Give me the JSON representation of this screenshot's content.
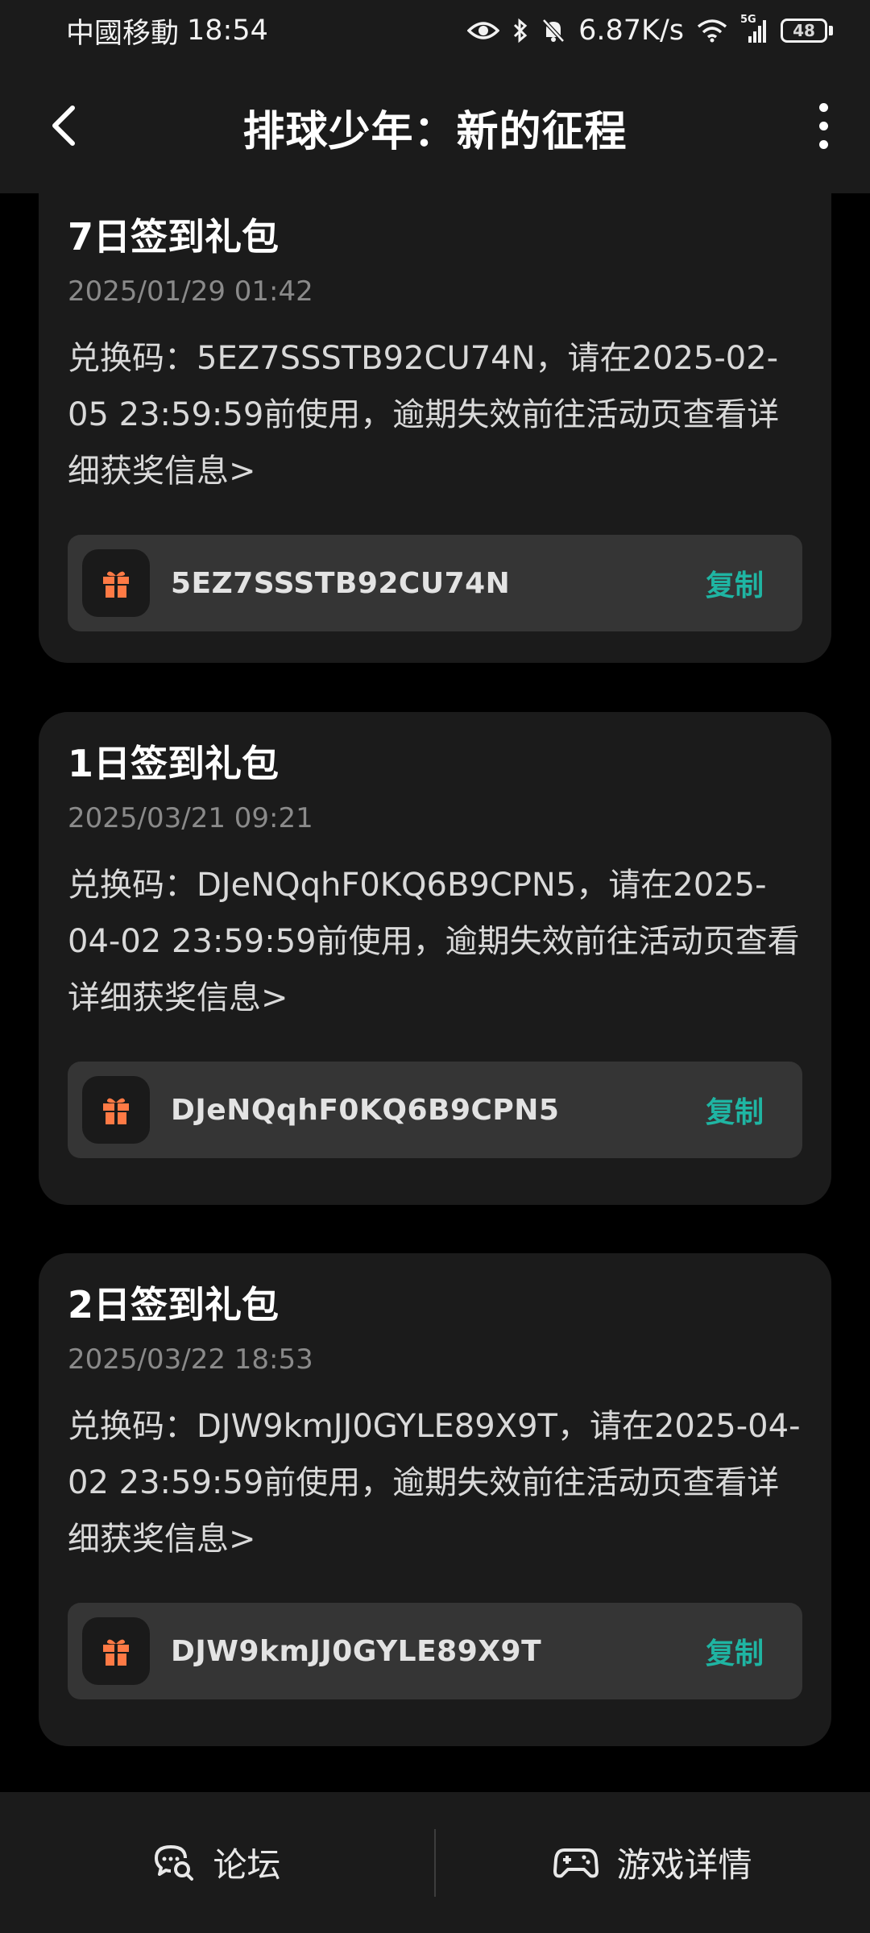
{
  "status_bar": {
    "carrier": "中國移動",
    "time": "18:54",
    "net_speed": "6.87K/s",
    "network_label": "5G",
    "battery": "48"
  },
  "header": {
    "title": "排球少年：新的征程"
  },
  "copy_label": "复制",
  "cards": [
    {
      "title": "7日签到礼包",
      "date": "2025/01/29 01:42",
      "description": "兑换码：5EZ7SSSTB92CU74N，请在2025-02-05 23:59:59前使用，逾期失效前往活动页查看详细获奖信息>",
      "code": "5EZ7SSSTB92CU74N"
    },
    {
      "title": "1日签到礼包",
      "date": "2025/03/21 09:21",
      "description": "兑换码：DJeNQqhF0KQ6B9CPN5，请在2025-04-02 23:59:59前使用，逾期失效前往活动页查看详细获奖信息>",
      "code": "DJeNQqhF0KQ6B9CPN5"
    },
    {
      "title": "2日签到礼包",
      "date": "2025/03/22 18:53",
      "description": "兑换码：DJW9kmJJ0GYLE89X9T，请在2025-04-02 23:59:59前使用，逾期失效前往活动页查看详细获奖信息>",
      "code": "DJW9kmJJ0GYLE89X9T"
    }
  ],
  "bottom_bar": {
    "forum_label": "论坛",
    "game_detail_label": "游戏详情"
  },
  "colors": {
    "accent": "#1fb5a3",
    "gift_icon": "#ff7a45",
    "card_bg": "#1b1b1b",
    "code_row_bg": "#353535"
  },
  "icons": [
    "back-arrow-icon",
    "more-vertical-icon",
    "gift-icon",
    "forum-chat-icon",
    "gamepad-icon",
    "eye-icon",
    "bluetooth-icon",
    "mute-bell-icon",
    "wifi-icon",
    "signal-icon",
    "battery-icon"
  ]
}
